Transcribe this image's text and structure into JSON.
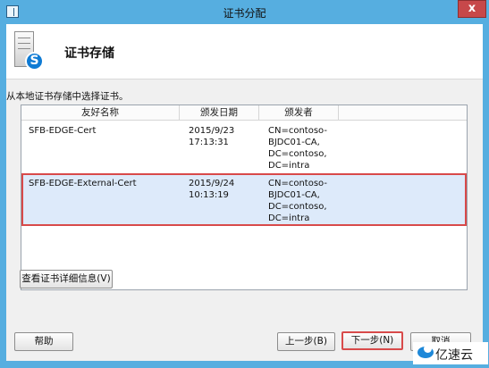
{
  "window": {
    "title": "证书分配",
    "close_label": "x"
  },
  "header": {
    "title": "证书存储",
    "icon_glyph": "S"
  },
  "instruction": "从本地证书存储中选择证书。",
  "table": {
    "columns": [
      "友好名称",
      "颁发日期",
      "颁发者"
    ],
    "rows": [
      {
        "name": "SFB-EDGE-Cert",
        "date": "2015/9/23\n17:13:31",
        "issuer": "CN=contoso-\nBJDC01-CA,\nDC=contoso,\nDC=intra"
      },
      {
        "name": "SFB-EDGE-External-Cert",
        "date": "2015/9/24\n10:13:19",
        "issuer": "CN=contoso-\nBJDC01-CA,\nDC=contoso,\nDC=intra"
      }
    ]
  },
  "buttons": {
    "details": "查看证书详细信息(V)",
    "help": "帮助",
    "back": "上一步(B)",
    "next": "下一步(N)",
    "cancel": "取消"
  },
  "watermark": {
    "text": "亿速云"
  },
  "colors": {
    "titlebar": "#56aee0",
    "highlight": "#d84a4a",
    "selected_row": "#ddeafa"
  }
}
